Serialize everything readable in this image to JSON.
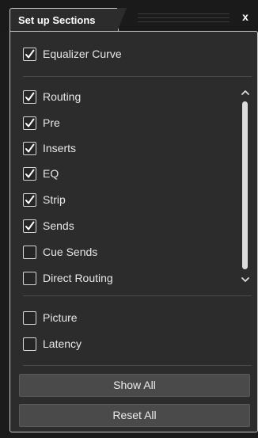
{
  "window": {
    "tab_title": "Set up Sections",
    "close_glyph": "x"
  },
  "sections": {
    "top": [
      {
        "label": "Equalizer Curve",
        "checked": true
      }
    ],
    "scroll_list": [
      {
        "label": "Routing",
        "checked": true
      },
      {
        "label": "Pre",
        "checked": true
      },
      {
        "label": "Inserts",
        "checked": true
      },
      {
        "label": "EQ",
        "checked": true
      },
      {
        "label": "Strip",
        "checked": true
      },
      {
        "label": "Sends",
        "checked": true
      },
      {
        "label": "Cue Sends",
        "checked": false
      },
      {
        "label": "Direct Routing",
        "checked": false
      }
    ],
    "bottom": [
      {
        "label": "Picture",
        "checked": false
      },
      {
        "label": "Latency",
        "checked": false
      }
    ]
  },
  "buttons": {
    "show_all": "Show All",
    "reset_all": "Reset All"
  },
  "icons": {
    "checkmark": "checkmark-icon",
    "scroll_up": "chevron-up-icon",
    "scroll_down": "chevron-down-icon",
    "close": "close-icon"
  },
  "colors": {
    "background": "#1b1b1b",
    "panel": "#2c2c2c",
    "button": "#4a4a4a",
    "border": "#c8c8c8"
  }
}
